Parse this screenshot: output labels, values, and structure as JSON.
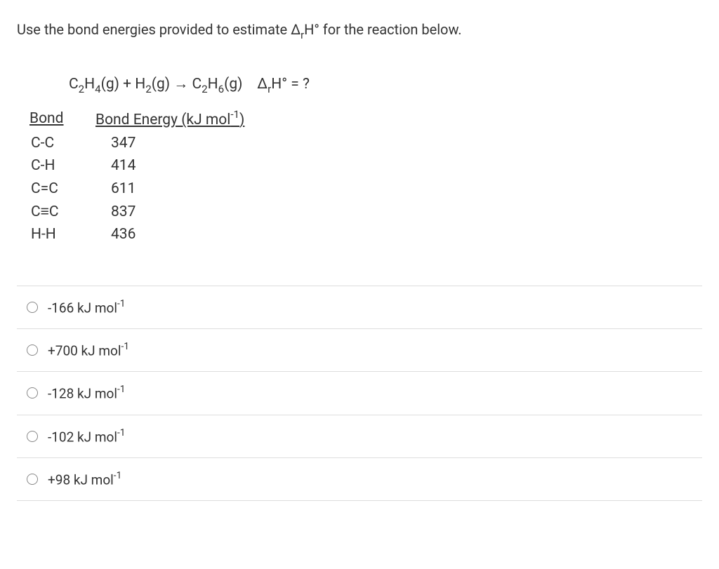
{
  "question": "Use the bond energies provided to estimate ΔrH° for the reaction below.",
  "equation": {
    "c2h4": "C2H4(g)",
    "plus1": " + ",
    "h2": "H2(g)",
    "arrow": " → ",
    "c2h6": "C2H6(g)",
    "spacer": "    ",
    "drh": "ΔrH° = ?"
  },
  "table": {
    "headers": {
      "bond": "Bond",
      "energy": "Bond Energy (kJ mol-1)"
    },
    "rows": [
      {
        "bond": "C-C",
        "energy": "347"
      },
      {
        "bond": "C-H",
        "energy": "414"
      },
      {
        "bond": "C=C",
        "energy": "611"
      },
      {
        "bond": "C≡C",
        "energy": "837"
      },
      {
        "bond": "H-H",
        "energy": "436"
      }
    ]
  },
  "options": [
    {
      "label": "-166 kJ mol-1"
    },
    {
      "label": "+700 kJ mol-1"
    },
    {
      "label": "-128 kJ mol-1"
    },
    {
      "label": "-102 kJ mol-1"
    },
    {
      "label": "+98 kJ mol-1"
    }
  ]
}
